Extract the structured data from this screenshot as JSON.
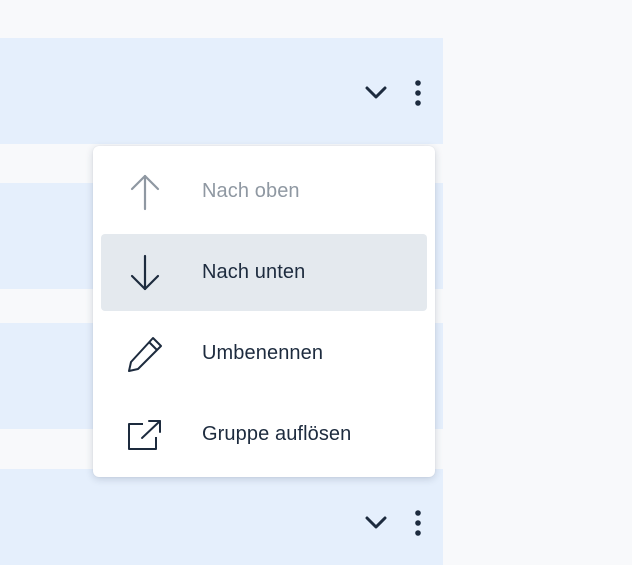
{
  "colors": {
    "page_background": "#f8f9fb",
    "row_background": "#e5effc",
    "menu_background": "#ffffff",
    "highlight": "#e4e9ee",
    "text": "#1d2b3e",
    "disabled_text": "#8f98a2"
  },
  "rows": [
    {
      "controls": {
        "expand_icon": "chevron-down-icon",
        "more_icon": "more-vertical-icon"
      }
    },
    {
      "controls": null
    },
    {
      "controls": null
    },
    {
      "controls": {
        "expand_icon": "chevron-down-icon",
        "more_icon": "more-vertical-icon"
      }
    }
  ],
  "menu": {
    "items": [
      {
        "label": "Nach oben",
        "icon": "arrow-up-icon",
        "state": "disabled"
      },
      {
        "label": "Nach unten",
        "icon": "arrow-down-icon",
        "state": "highlighted"
      },
      {
        "label": "Umbenennen",
        "icon": "pencil-icon",
        "state": "enabled"
      },
      {
        "label": "Gruppe auflösen",
        "icon": "ungroup-icon",
        "state": "enabled"
      }
    ]
  }
}
